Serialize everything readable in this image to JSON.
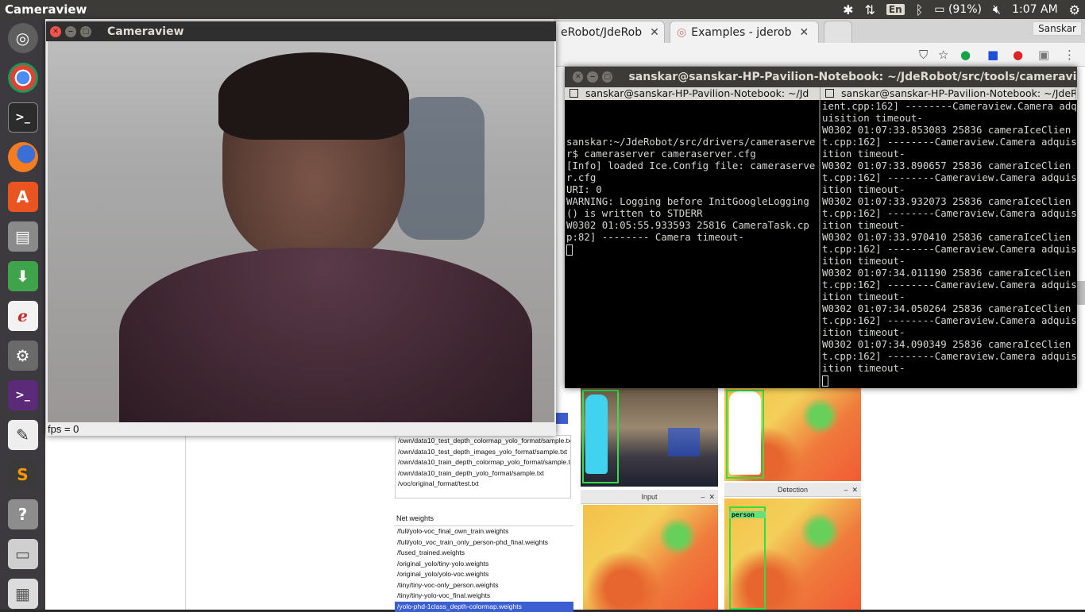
{
  "top_panel": {
    "app_title": "Cameraview",
    "keyboard": "En",
    "battery": "(91%)",
    "clock": "1:07 AM"
  },
  "launcher": {
    "items": [
      "ubuntu-dash-icon",
      "chrome-icon",
      "terminal-icon",
      "firefox-icon",
      "software-center-icon",
      "files-icon",
      "downloader-icon",
      "document-viewer-icon",
      "settings-icon",
      "terminal-alt-icon",
      "text-editor-icon",
      "sublime-icon",
      "help-icon",
      "drive-icon",
      "printer-icon"
    ]
  },
  "browser": {
    "tabs": [
      {
        "label": "eRobot/JdeRob"
      },
      {
        "label": "Examples - jderob"
      }
    ],
    "user": "Sanskar"
  },
  "gui_app": {
    "datasets": [
      "/own/data10_test_depth_colormap_yolo_format/sample.txt",
      "/own/data10_test_depth_images_yolo_format/sample.txt",
      "/own/data10_train_depth_colormap_yolo_format/sample.t",
      "/own/data10_train_depth_yolo_format/sample.txt",
      "/voc/original_format/test.txt"
    ],
    "net_weights_label": "Net weights",
    "net_weights": [
      "/full/yolo-voc_final_own_train.weights",
      "/full/yolo_voc_train_only_person-phd_final.weights",
      "/fused_trained.weights",
      "/original_yolo/tiny-yolo.weights",
      "/original_yolo/yolo-voc.weights",
      "/tiny/tiny-voc-only_person.weights",
      "/tiny/tiny-yolo-voc_final.weights",
      "/yolo-phd-1class_depth-colormap.weights"
    ],
    "input_title": "Input",
    "detection_title": "Detection",
    "detection_label": "person"
  },
  "cameraview": {
    "title": "Cameraview",
    "fps": "fps = 0"
  },
  "terminal": {
    "title": "sanskar@sanskar-HP-Pavilion-Notebook: ~/JdeRobot/src/tools/cameraview",
    "tab_left": "sanskar@sanskar-HP-Pavilion-Notebook: ~/Jd",
    "tab_right": "sanskar@sanskar-HP-Pavilion-Notebook: ~/JdeRob",
    "left_pane": "sanskar:~/JdeRobot/src/drivers/cameraserver$ cameraserver cameraserver.cfg\n[Info] loaded Ice.Config file: cameraserver.cfg\nURI: 0\nWARNING: Logging before InitGoogleLogging() is written to STDERR\nW0302 01:05:55.933593 25816 CameraTask.cpp:82] -------- Camera timeout-",
    "right_pane": "ient.cpp:162] --------Cameraview.Camera adquisition timeout-\nW0302 01:07:33.853083 25836 cameraIceClient.cpp:162] --------Cameraview.Camera adquisition timeout-\nW0302 01:07:33.890657 25836 cameraIceClient.cpp:162] --------Cameraview.Camera adquisition timeout-\nW0302 01:07:33.932073 25836 cameraIceClient.cpp:162] --------Cameraview.Camera adquisition timeout-\nW0302 01:07:33.970410 25836 cameraIceClient.cpp:162] --------Cameraview.Camera adquisition timeout-\nW0302 01:07:34.011190 25836 cameraIceClient.cpp:162] --------Cameraview.Camera adquisition timeout-\nW0302 01:07:34.050264 25836 cameraIceClient.cpp:162] --------Cameraview.Camera adquisition timeout-\nW0302 01:07:34.090349 25836 cameraIceClient.cpp:162] --------Cameraview.Camera adquisition timeout-"
  }
}
